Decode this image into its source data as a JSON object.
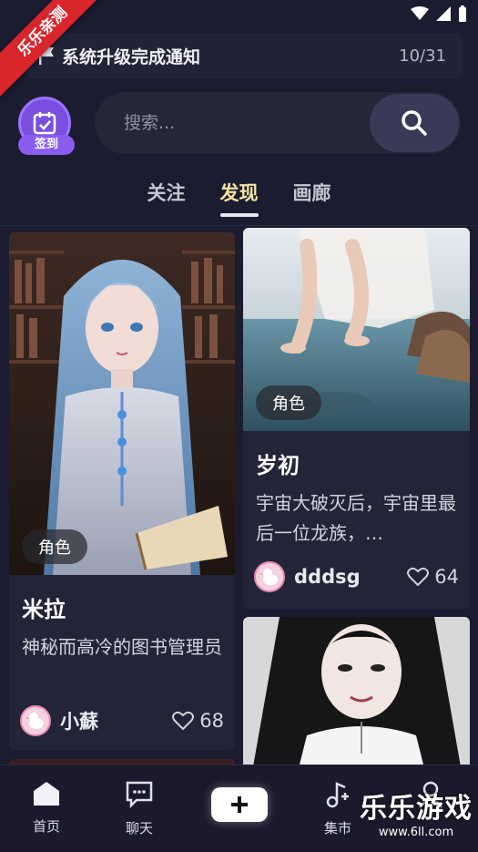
{
  "ribbon": {
    "text": "乐乐亲测"
  },
  "notice": {
    "title": "系统升级完成通知",
    "count": "10/31"
  },
  "checkin": {
    "label": "签到"
  },
  "search": {
    "placeholder": "搜索..."
  },
  "tabs": [
    {
      "label": "关注",
      "active": false
    },
    {
      "label": "发现",
      "active": true
    },
    {
      "label": "画廊",
      "active": false
    }
  ],
  "cards": [
    {
      "tag": "角色",
      "title": "米拉",
      "desc": "神秘而高冷的图书管理员",
      "author": "小蘇",
      "likes": "68"
    },
    {
      "tag": "角色",
      "title": "岁初",
      "desc": "宇宙大破灭后，宇宙里最后一位龙族，…",
      "author": "dddsg",
      "likes": "64"
    }
  ],
  "nav": {
    "home": "首页",
    "chat": "聊天",
    "market": "集市",
    "add": "+"
  },
  "watermark": {
    "big": "乐乐游戏",
    "small": "www.6ll.com"
  },
  "colors": {
    "accent": "#7a4fe0",
    "active_tab": "#f2e3a6",
    "background": "#1c1c30"
  }
}
